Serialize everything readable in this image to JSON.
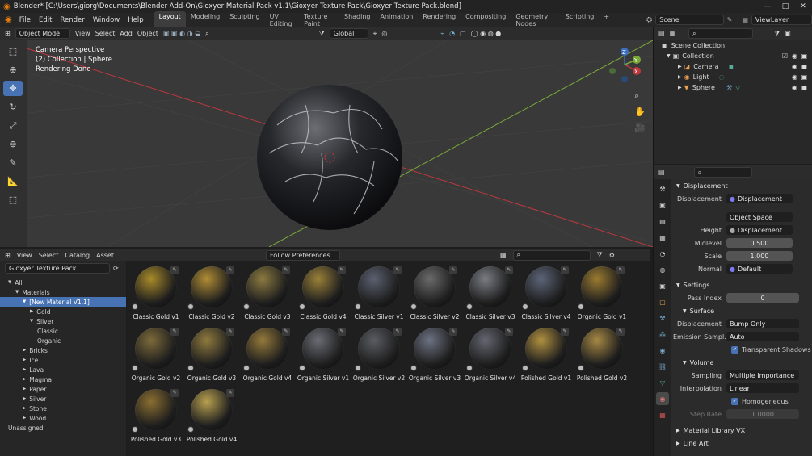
{
  "window": {
    "title": "Blender* [C:\\Users\\giorg\\Documents\\Blender Add-On\\Gioxyer Material Pack v1.1\\Gioxyer Texture Pack\\Gioxyer Texture Pack.blend]",
    "minimize": "—",
    "maximize": "□",
    "close": "✕"
  },
  "menu": [
    "File",
    "Edit",
    "Render",
    "Window",
    "Help"
  ],
  "workspaces": [
    "Layout",
    "Modeling",
    "Sculpting",
    "UV Editing",
    "Texture Paint",
    "Shading",
    "Animation",
    "Rendering",
    "Compositing",
    "Geometry Nodes",
    "Scripting"
  ],
  "workspace_add": "+",
  "scene": {
    "name": "Scene",
    "view_layer": "ViewLayer"
  },
  "viewport": {
    "mode": "Object Mode",
    "menus": [
      "View",
      "Select",
      "Add",
      "Object"
    ],
    "transform": "Global",
    "overlay_lines": [
      "Camera Perspective",
      "(2) Collection | Sphere",
      "Rendering Done"
    ],
    "gizmo": {
      "z": "Z",
      "y": "Y",
      "x": "X"
    }
  },
  "tools": [
    "cursor-select",
    "cursor",
    "move",
    "rotate",
    "scale",
    "transform",
    "annotate",
    "measure",
    "add-cube"
  ],
  "outliner": {
    "root": "Scene Collection",
    "collection": "Collection",
    "items": [
      "Camera",
      "Light",
      "Sphere"
    ]
  },
  "properties": {
    "displacement_panel": "Displacement",
    "displacement_label": "Displacement",
    "displacement_value": "Displacement",
    "space_value": "Object Space",
    "height_label": "Height",
    "height_value": "Displacement",
    "midlevel_label": "Midlevel",
    "midlevel_value": "0.500",
    "scale_label": "Scale",
    "scale_value": "1.000",
    "normal_label": "Normal",
    "normal_value": "Default",
    "settings_panel": "Settings",
    "pass_index_label": "Pass Index",
    "pass_index_value": "0",
    "surface_panel": "Surface",
    "surf_displacement_label": "Displacement",
    "surf_displacement_value": "Bump Only",
    "emission_label": "Emission Sampl...",
    "emission_value": "Auto",
    "transparent_shadows": "Transparent Shadows",
    "volume_panel": "Volume",
    "sampling_label": "Sampling",
    "sampling_value": "Multiple Importance",
    "interpolation_label": "Interpolation",
    "interpolation_value": "Linear",
    "homogeneous": "Homogeneous",
    "step_rate_label": "Step Rate",
    "step_rate_value": "1.0000",
    "library_panel": "Material Library VX",
    "line_art_panel": "Line Art"
  },
  "browser": {
    "menus": [
      "View",
      "Select",
      "Catalog",
      "Asset"
    ],
    "preferences": "Follow Preferences",
    "library": "Gioxyer Texture Pack",
    "tree": [
      {
        "label": "All",
        "indent": 0,
        "arrow": "▼"
      },
      {
        "label": "Materials",
        "indent": 1,
        "arrow": "▼"
      },
      {
        "label": "[New Material V1.1]",
        "indent": 2,
        "arrow": "▼",
        "selected": true
      },
      {
        "label": "Gold",
        "indent": 3,
        "arrow": "▶"
      },
      {
        "label": "Silver",
        "indent": 3,
        "arrow": "▼"
      },
      {
        "label": "Classic",
        "indent": 4,
        "arrow": ""
      },
      {
        "label": "Organic",
        "indent": 4,
        "arrow": ""
      },
      {
        "label": "Bricks",
        "indent": 2,
        "arrow": "▶"
      },
      {
        "label": "Ice",
        "indent": 2,
        "arrow": "▶"
      },
      {
        "label": "Lava",
        "indent": 2,
        "arrow": "▶"
      },
      {
        "label": "Magma",
        "indent": 2,
        "arrow": "▶"
      },
      {
        "label": "Paper",
        "indent": 2,
        "arrow": "▶"
      },
      {
        "label": "Silver",
        "indent": 2,
        "arrow": "▶"
      },
      {
        "label": "Stone",
        "indent": 2,
        "arrow": "▶"
      },
      {
        "label": "Wood",
        "indent": 2,
        "arrow": "▶"
      },
      {
        "label": "Unassigned",
        "indent": 0,
        "arrow": ""
      }
    ],
    "assets": [
      {
        "name": "Classic Gold v1",
        "color": "#a88a2a"
      },
      {
        "name": "Classic Gold v2",
        "color": "#b08d35"
      },
      {
        "name": "Classic Gold v3",
        "color": "#8c7a40"
      },
      {
        "name": "Classic Gold v4",
        "color": "#9a8038"
      },
      {
        "name": "Classic Silver v1",
        "color": "#5a6070"
      },
      {
        "name": "Classic Silver v2",
        "color": "#6a6a6a"
      },
      {
        "name": "Classic Silver v3",
        "color": "#7a7c84"
      },
      {
        "name": "Classic Silver v4",
        "color": "#5c6478"
      },
      {
        "name": "Organic Gold v1",
        "color": "#9a7a30"
      },
      {
        "name": "Organic Gold v2",
        "color": "#7c6a3a"
      },
      {
        "name": "Organic Gold v3",
        "color": "#8f7a3e"
      },
      {
        "name": "Organic Gold v4",
        "color": "#94793a"
      },
      {
        "name": "Organic Silver v1",
        "color": "#6a6c74"
      },
      {
        "name": "Organic Silver v2",
        "color": "#5a5c62"
      },
      {
        "name": "Organic Silver v3",
        "color": "#6c7282"
      },
      {
        "name": "Organic Silver v4",
        "color": "#646670"
      },
      {
        "name": "Polished Gold v1",
        "color": "#b09040"
      },
      {
        "name": "Polished Gold v2",
        "color": "#a68844"
      },
      {
        "name": "Polished Gold v3",
        "color": "#8a6e30"
      },
      {
        "name": "Polished Gold v4",
        "color": "#b8a050"
      }
    ]
  },
  "colors": {
    "accent": "#4772b3",
    "axis_x": "#c0383e",
    "axis_y": "#7aa838"
  }
}
